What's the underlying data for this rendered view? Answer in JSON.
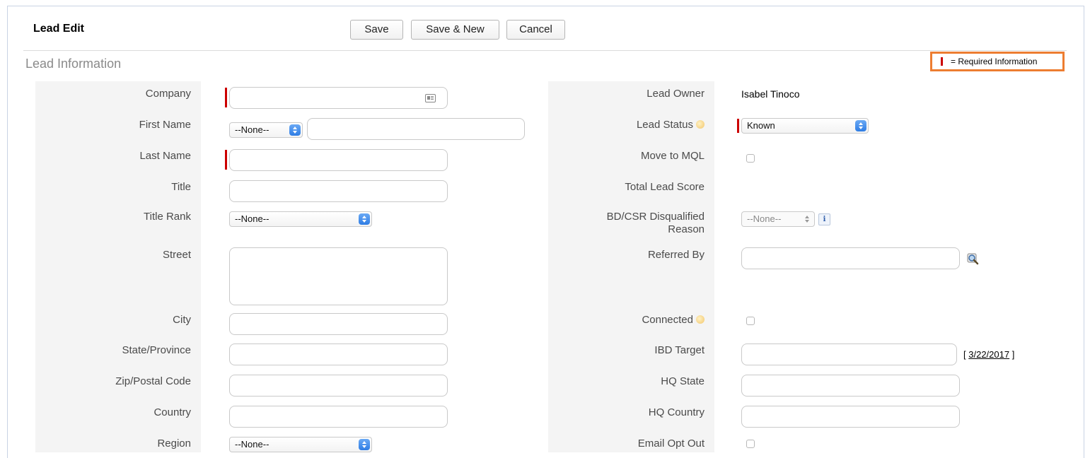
{
  "header": {
    "title": "Lead Edit",
    "save_label": "Save",
    "save_new_label": "Save & New",
    "cancel_label": "Cancel"
  },
  "section": {
    "title": "Lead Information",
    "required_legend": "= Required Information"
  },
  "left_fields": {
    "company": "Company",
    "first_name": "First Name",
    "salutation_value": "--None--",
    "last_name": "Last Name",
    "title": "Title",
    "title_rank": "Title Rank",
    "title_rank_value": "--None--",
    "street": "Street",
    "city": "City",
    "state": "State/Province",
    "zip": "Zip/Postal Code",
    "country": "Country",
    "region": "Region",
    "region_value": "--None--"
  },
  "right_fields": {
    "lead_owner": "Lead Owner",
    "lead_owner_value": "Isabel Tinoco",
    "lead_status": "Lead Status",
    "lead_status_value": "Known",
    "move_to_mql": "Move to MQL",
    "total_lead_score": "Total Lead Score",
    "bd_csr_line1": "BD/CSR Disqualified",
    "bd_csr_line2": "Reason",
    "bd_csr_value": "--None--",
    "info_glyph": "i",
    "referred_by": "Referred By",
    "connected": "Connected",
    "ibd_target": "IBD Target",
    "ibd_date_open": "[",
    "ibd_date": "3/22/2017",
    "ibd_date_close": "]",
    "hq_state": "HQ State",
    "hq_country": "HQ Country",
    "email_opt_out": "Email Opt Out"
  },
  "colors": {
    "required": "#cc0000",
    "highlight": "#ed7d31",
    "select_arrow": "#2f7de4"
  }
}
